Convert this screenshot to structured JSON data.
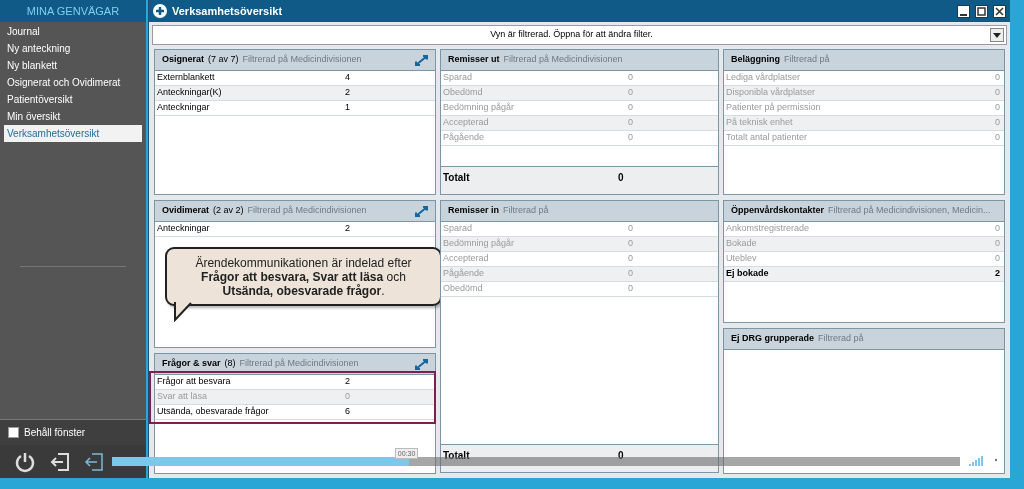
{
  "sidebar": {
    "title": "MINA GENVÄGAR",
    "items": [
      {
        "label": "Journal",
        "selected": false
      },
      {
        "label": "Ny anteckning",
        "selected": false
      },
      {
        "label": "Ny blankett",
        "selected": false
      },
      {
        "label": "Osignerat och Ovidimerat",
        "selected": false
      },
      {
        "label": "Patientöversikt",
        "selected": false
      },
      {
        "label": "Min översikt",
        "selected": false
      },
      {
        "label": "Verksamhetsöversikt",
        "selected": true
      }
    ],
    "keep_window": {
      "label": "Behåll fönster",
      "checked": false
    }
  },
  "window": {
    "title": "Verksamhetsöversikt"
  },
  "filter_bar": {
    "text": "Vyn är filtrerad. Öppna för att ändra filter."
  },
  "columns": [
    {
      "panels": [
        {
          "title": "Osignerat",
          "count": "(7 av 7)",
          "filter": "Filtrerad på Medicindivisionen",
          "expandable": true,
          "rows": [
            {
              "label": "Externblankett",
              "value": "4",
              "dimmed": false,
              "bold": false
            },
            {
              "label": "Anteckningar(K)",
              "value": "2",
              "dimmed": false,
              "bold": false
            },
            {
              "label": "Anteckningar",
              "value": "1",
              "dimmed": false,
              "bold": false
            }
          ]
        },
        {
          "title": "Ovidimerat",
          "count": "(2 av 2)",
          "filter": "Filtrerad på Medicindivisionen",
          "expandable": true,
          "rows": [
            {
              "label": "Anteckningar",
              "value": "2",
              "dimmed": false,
              "bold": false
            }
          ],
          "callout": "Ärendekommunikationen är indelad efter **Frågor att besvara, Svar att läsa** och **Utsända, obesvarade frågor**."
        },
        {
          "title": "Frågor & svar",
          "count": "(8)",
          "filter": "Filtrerad på Medicindivisionen",
          "expandable": true,
          "highlighted": true,
          "rows": [
            {
              "label": "Frågor att besvara",
              "value": "2",
              "dimmed": false,
              "bold": false
            },
            {
              "label": "Svar att läsa",
              "value": "0",
              "dimmed": true,
              "bold": false
            },
            {
              "label": "Utsända, obesvarade frågor",
              "value": "6",
              "dimmed": false,
              "bold": false
            }
          ]
        }
      ]
    },
    {
      "panels": [
        {
          "title": "Remisser ut",
          "filter": "Filtrerad på Medicindivisionen",
          "expandable": false,
          "rows": [
            {
              "label": "Sparad",
              "value": "0",
              "dimmed": true,
              "bold": false
            },
            {
              "label": "Obedömd",
              "value": "0",
              "dimmed": true,
              "bold": false
            },
            {
              "label": "Bedömning pågår",
              "value": "0",
              "dimmed": true,
              "bold": false
            },
            {
              "label": "Accepterad",
              "value": "0",
              "dimmed": true,
              "bold": false
            },
            {
              "label": "Pågående",
              "value": "0",
              "dimmed": true,
              "bold": false
            }
          ],
          "total": {
            "label": "Totalt",
            "value": "0"
          }
        },
        {
          "title": "Remisser in",
          "filter": "Filtrerad på",
          "expandable": false,
          "rows": [
            {
              "label": "Sparad",
              "value": "0",
              "dimmed": true,
              "bold": false
            },
            {
              "label": "Bedömning pågår",
              "value": "0",
              "dimmed": true,
              "bold": false
            },
            {
              "label": "Accepterad",
              "value": "0",
              "dimmed": true,
              "bold": false
            },
            {
              "label": "Pågående",
              "value": "0",
              "dimmed": true,
              "bold": false
            },
            {
              "label": "Obedömd",
              "value": "0",
              "dimmed": true,
              "bold": false
            }
          ],
          "total": {
            "label": "Totalt",
            "value": "0"
          }
        }
      ]
    },
    {
      "panels": [
        {
          "title": "Beläggning",
          "filter": "Filtrerad på",
          "expandable": false,
          "rows": [
            {
              "label": "Lediga vårdplatser",
              "value": "0",
              "dimmed": true,
              "bold": false
            },
            {
              "label": "Disponibla vårdplatser",
              "value": "0",
              "dimmed": true,
              "bold": false
            },
            {
              "label": "Patienter på permission",
              "value": "0",
              "dimmed": true,
              "bold": false
            },
            {
              "label": "På teknisk enhet",
              "value": "0",
              "dimmed": true,
              "bold": false
            },
            {
              "label": "Totalt antal patienter",
              "value": "0",
              "dimmed": true,
              "bold": false
            }
          ]
        },
        {
          "title": "Öppenvårdskontakter",
          "filter": "Filtrerad på Medicindivisionen, Medicin...",
          "expandable": false,
          "rows": [
            {
              "label": "Ankomstregistrerade",
              "value": "0",
              "dimmed": true,
              "bold": false
            },
            {
              "label": "Bokade",
              "value": "0",
              "dimmed": true,
              "bold": false
            },
            {
              "label": "Uteblev",
              "value": "0",
              "dimmed": true,
              "bold": false
            },
            {
              "label": "Ej bokade",
              "value": "2",
              "dimmed": false,
              "bold": true
            }
          ]
        },
        {
          "title": "Ej DRG grupperade",
          "filter": "Filtrerad på",
          "expandable": false
        }
      ]
    }
  ],
  "video_player": {
    "time": "00:30",
    "level": 0.35
  }
}
